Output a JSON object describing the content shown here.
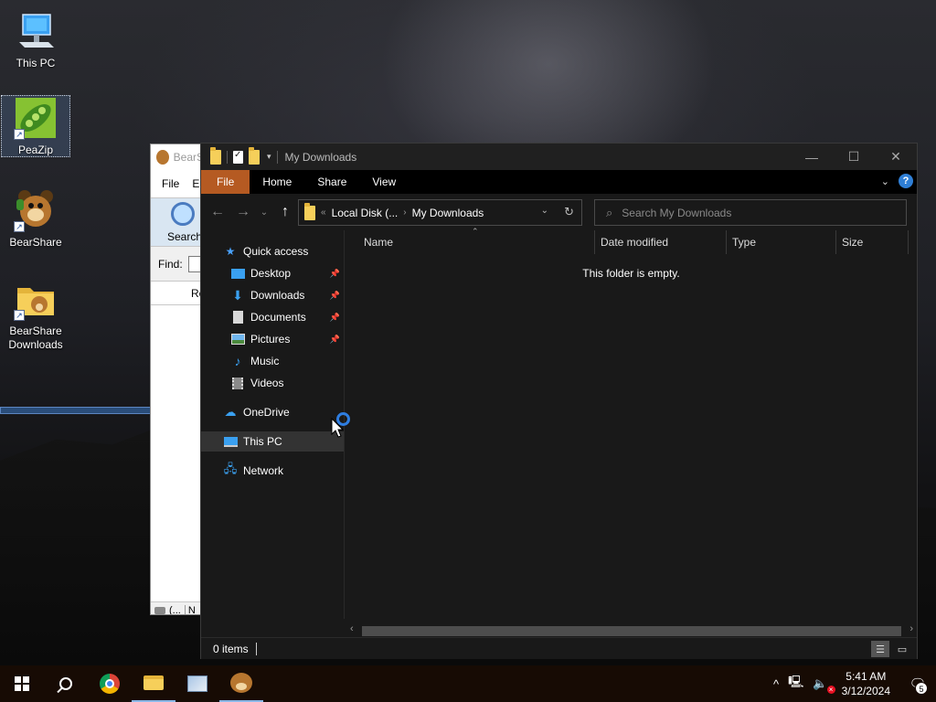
{
  "desktop": {
    "icons": [
      {
        "label": "This PC",
        "icon": "computer-icon"
      },
      {
        "label": "PeaZip",
        "icon": "peazip-icon"
      },
      {
        "label": "BearShare",
        "icon": "bearshare-icon"
      },
      {
        "label": "BearShare Downloads",
        "icon": "folder-icon"
      }
    ]
  },
  "bearshare": {
    "title": "BearS",
    "menu": [
      "File",
      "E"
    ],
    "search_label": "Search",
    "find_label": "Find:",
    "re_label": "Re",
    "status": [
      "(...",
      "N"
    ]
  },
  "explorer": {
    "title": "My Downloads",
    "ribbon": {
      "file": "File",
      "tabs": [
        "Home",
        "Share",
        "View"
      ]
    },
    "address": {
      "crumbs": [
        "Local Disk (...",
        "My Downloads"
      ]
    },
    "search": {
      "placeholder": "Search My Downloads"
    },
    "nav": {
      "quick_access": "Quick access",
      "items": [
        "Desktop",
        "Downloads",
        "Documents",
        "Pictures",
        "Music",
        "Videos"
      ],
      "onedrive": "OneDrive",
      "this_pc": "This PC",
      "network": "Network"
    },
    "columns": [
      "Name",
      "Date modified",
      "Type",
      "Size"
    ],
    "empty_message": "This folder is empty.",
    "status": "0 items"
  },
  "taskbar": {
    "time": "5:41 AM",
    "date": "3/12/2024",
    "notifications": "5"
  },
  "colors": {
    "file_tab": "#b55a22",
    "accent": "#2e7de0",
    "taskbar": "#170b04"
  }
}
